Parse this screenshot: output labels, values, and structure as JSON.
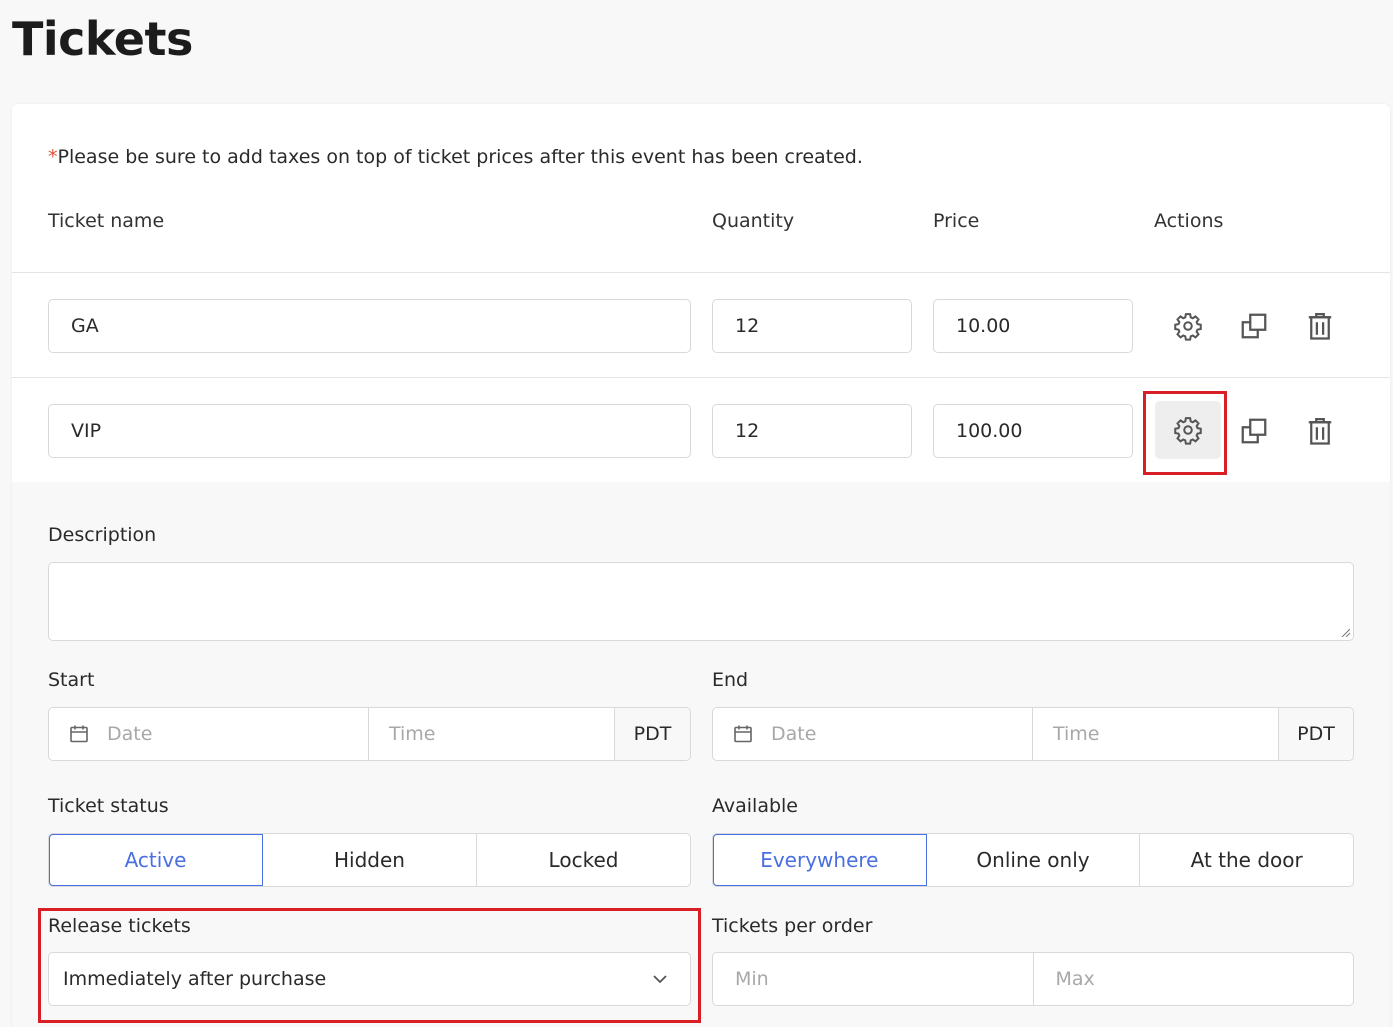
{
  "page": {
    "title": "Tickets"
  },
  "notice": {
    "asterisk": "*",
    "text": "Please be sure to add taxes on top of ticket prices after this event has been created."
  },
  "columns": {
    "name": "Ticket name",
    "quantity": "Quantity",
    "price": "Price",
    "actions": "Actions"
  },
  "tickets": [
    {
      "name": "GA",
      "quantity": "12",
      "price": "10.00"
    },
    {
      "name": "VIP",
      "quantity": "12",
      "price": "100.00"
    }
  ],
  "icons": {
    "settings": "gear-icon",
    "duplicate": "copy-icon",
    "delete": "trash-icon",
    "calendar": "calendar-icon",
    "dropdown": "chevron-down-icon"
  },
  "settings": {
    "description_label": "Description",
    "start": {
      "label": "Start",
      "date_placeholder": "Date",
      "time_placeholder": "Time",
      "timezone": "PDT"
    },
    "end": {
      "label": "End",
      "date_placeholder": "Date",
      "time_placeholder": "Time",
      "timezone": "PDT"
    },
    "ticket_status": {
      "label": "Ticket status",
      "options": [
        "Active",
        "Hidden",
        "Locked"
      ],
      "selected": "Active"
    },
    "available": {
      "label": "Available",
      "options": [
        "Everywhere",
        "Online only",
        "At the door"
      ],
      "selected": "Everywhere"
    },
    "release": {
      "label": "Release tickets",
      "value": "Immediately after purchase"
    },
    "per_order": {
      "label": "Tickets per order",
      "min_placeholder": "Min",
      "max_placeholder": "Max"
    }
  },
  "colors": {
    "accent": "#4a6fe0",
    "highlight": "#d91f26",
    "required": "#e2543d"
  }
}
